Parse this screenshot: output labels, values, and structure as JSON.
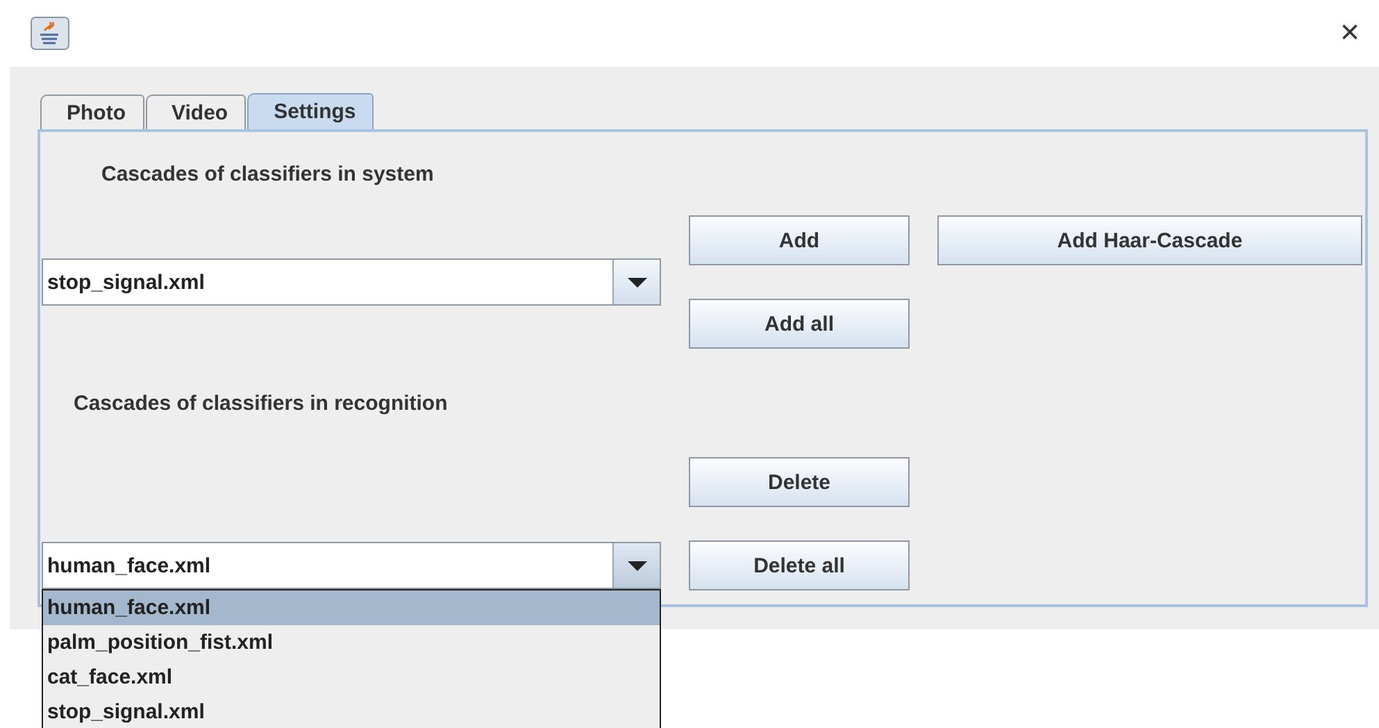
{
  "window": {
    "close": "×"
  },
  "tabs": [
    {
      "label": "Photo",
      "selected": false
    },
    {
      "label": "Video",
      "selected": false
    },
    {
      "label": "Settings",
      "selected": true
    }
  ],
  "system": {
    "label": "Cascades of classifiers in system",
    "combo": {
      "value": "stop_signal.xml"
    },
    "buttons": [
      "Add",
      "Add all"
    ],
    "extra_button": "Add Haar-Cascade"
  },
  "recognition": {
    "label": "Cascades of classifiers in recognition",
    "combo": {
      "value": "human_face.xml",
      "expanded": true,
      "options": [
        {
          "label": "human_face.xml",
          "selected": true
        },
        {
          "label": "palm_position_fist.xml",
          "selected": false
        },
        {
          "label": "cat_face.xml",
          "selected": false
        },
        {
          "label": "stop_signal.xml",
          "selected": false
        }
      ]
    },
    "buttons": [
      "Delete",
      "Delete all"
    ]
  }
}
